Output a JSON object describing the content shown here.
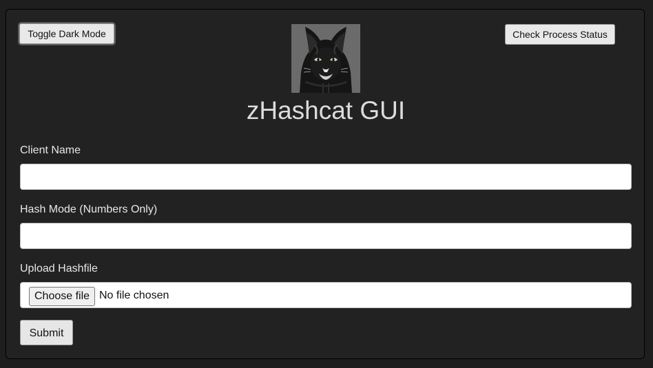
{
  "header": {
    "toggle_dark_mode_label": "Toggle Dark Mode",
    "check_process_status_label": "Check Process Status",
    "logo_icon": "cat-hoodie-logo",
    "title": "zHashcat GUI"
  },
  "form": {
    "client_name": {
      "label": "Client Name",
      "value": ""
    },
    "hash_mode": {
      "label": "Hash Mode (Numbers Only)",
      "value": ""
    },
    "hashfile": {
      "label": "Upload Hashfile",
      "choose_label": "Choose file",
      "status": "No file chosen"
    },
    "submit_label": "Submit"
  },
  "colors": {
    "page_background": "#1e1e1e",
    "panel_background": "#222222",
    "title_text": "#dcdcdc",
    "label_text": "#e8e8e8"
  }
}
